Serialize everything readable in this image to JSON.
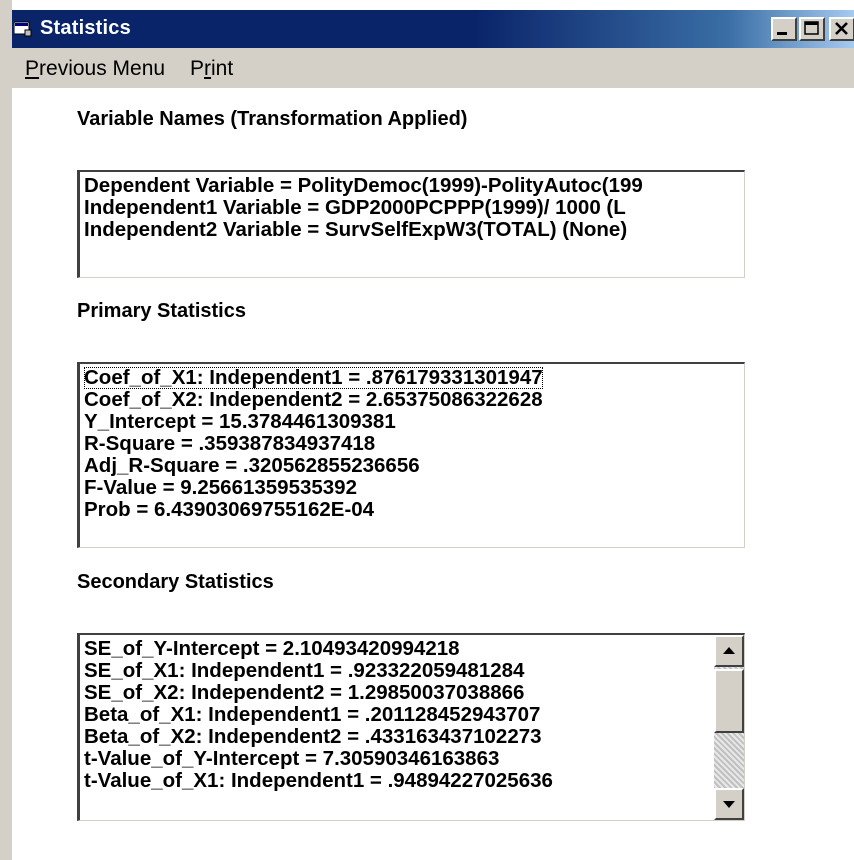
{
  "window": {
    "title": "Statistics",
    "controls": {
      "minimize": "_",
      "maximize": "□",
      "close": "×"
    }
  },
  "menu": {
    "previous_menu": {
      "first": "P",
      "rest": "revious Menu"
    },
    "print": {
      "first": "P",
      "mid": "r",
      "rest": "int"
    }
  },
  "variable_names": {
    "label": "Variable Names (Transformation Applied)",
    "lines": [
      "Dependent Variable = PolityDemoc(1999)-PolityAutoc(199",
      "Independent1 Variable = GDP2000PCPPP(1999)/ 1000 (L",
      "Independent2 Variable = SurvSelfExpW3(TOTAL) (None)"
    ]
  },
  "primary": {
    "label": "Primary Statistics",
    "lines": [
      "Coef_of_X1: Independent1 =  .876179331301947",
      "Coef_of_X2: Independent2 =  2.65375086322628",
      "Y_Intercept =  15.3784461309381",
      "R-Square =  .359387834937418",
      "Adj_R-Square =  .320562855236656",
      "F-Value =  9.25661359535392",
      "Prob =  6.43903069755162E-04"
    ]
  },
  "secondary": {
    "label": "Secondary Statistics",
    "lines": [
      "SE_of_Y-Intercept =  2.10493420994218",
      "SE_of_X1: Independent1 =  .923322059481284",
      "SE_of_X2: Independent2 =  1.29850037038866",
      "Beta_of_X1: Independent1 =  .201128452943707",
      "Beta_of_X2: Independent2 =  .433163437102273",
      "t-Value_of_Y-Intercept =  7.30590346163863",
      "t-Value_of_X1: Independent1 =  .94894227025636"
    ]
  },
  "colors": {
    "titlebar": "#0a246a",
    "face": "#d4d0c8",
    "list_bg": "#ffffff"
  }
}
